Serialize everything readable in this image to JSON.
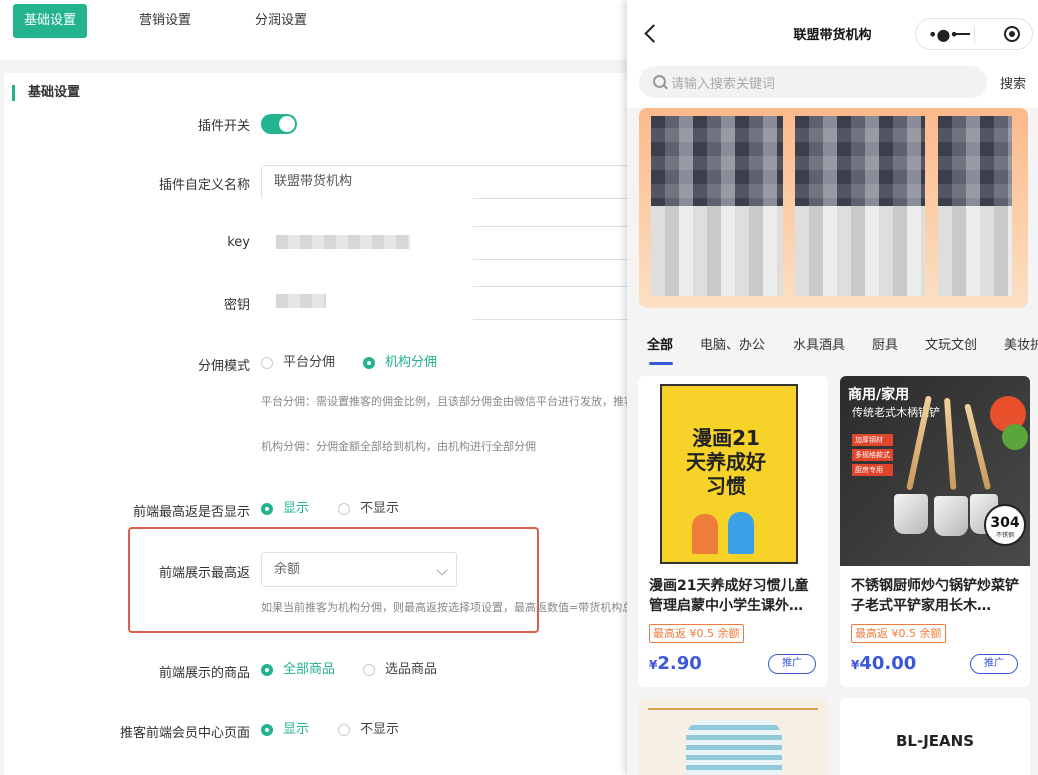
{
  "top_tabs": [
    "基础设置",
    "营销设置",
    "分润设置"
  ],
  "section_title": "基础设置",
  "form": {
    "plugin_switch_label": "插件开关",
    "plugin_switch_on": true,
    "custom_name_label": "插件自定义名称",
    "custom_name_value": "联盟带货机构",
    "key_label": "key",
    "secret_label": "密钥",
    "commission_mode_label": "分佣模式",
    "commission_options": [
      "平台分佣",
      "机构分佣"
    ],
    "commission_selected": "机构分佣",
    "hint_platform": "平台分佣：需设置推客的佣金比例，且该部分佣金由微信平台进行发放，推客",
    "hint_org": "机构分佣：分佣金额全部给到机构，由机构进行全部分佣",
    "show_max_return_label": "前端最高返是否显示",
    "show_max_return_options": [
      "显示",
      "不显示"
    ],
    "show_max_return_selected": "显示",
    "display_max_return_label": "前端展示最高返",
    "display_max_return_value": "余额",
    "hint_max_return": "如果当前推客为机构分佣，则最高返按选择项设置，最高返数值=带货机构总佣",
    "display_products_label": "前端展示的商品",
    "display_products_options": [
      "全部商品",
      "选品商品"
    ],
    "display_products_selected": "全部商品",
    "member_page_label": "推客前端会员中心页面",
    "member_page_options": [
      "显示",
      "不显示"
    ],
    "member_page_selected": "显示"
  },
  "phone": {
    "title": "联盟带货机构",
    "search_placeholder": "请输入搜索关键词",
    "search_button": "搜索",
    "categories": [
      "全部",
      "电脑、办公",
      "水具酒具",
      "厨具",
      "文玩文创",
      "美妆护"
    ],
    "active_category": "全部",
    "products": [
      {
        "name": "漫画21天养成好习惯儿童管理启蒙中小学生课外…",
        "tag": "最高返 ¥0.5 余额",
        "price_symbol": "¥",
        "price": "2.90",
        "button": "推广",
        "cover_text": "漫画21天养成好习惯"
      },
      {
        "name": "不锈钢厨师炒勺锅铲炒菜铲子老式平铲家用长木…",
        "tag": "最高返 ¥0.5 余额",
        "price_symbol": "¥",
        "price": "40.00",
        "button": "推广",
        "cover_title": "商用/家用",
        "cover_sub": "传统老式木柄锅铲",
        "cover_badges": [
          "加厚钢材",
          "多规格款式",
          "厨房专用"
        ],
        "cover_stamp": "304",
        "cover_stamp_sub": "不锈钢"
      },
      {
        "brand_text": "BL-JEANS"
      }
    ]
  },
  "colors": {
    "accent": "#23b38f",
    "highlight_box": "#e05a4e",
    "price_blue": "#3a58d8",
    "tag_orange": "#f07a3c"
  }
}
